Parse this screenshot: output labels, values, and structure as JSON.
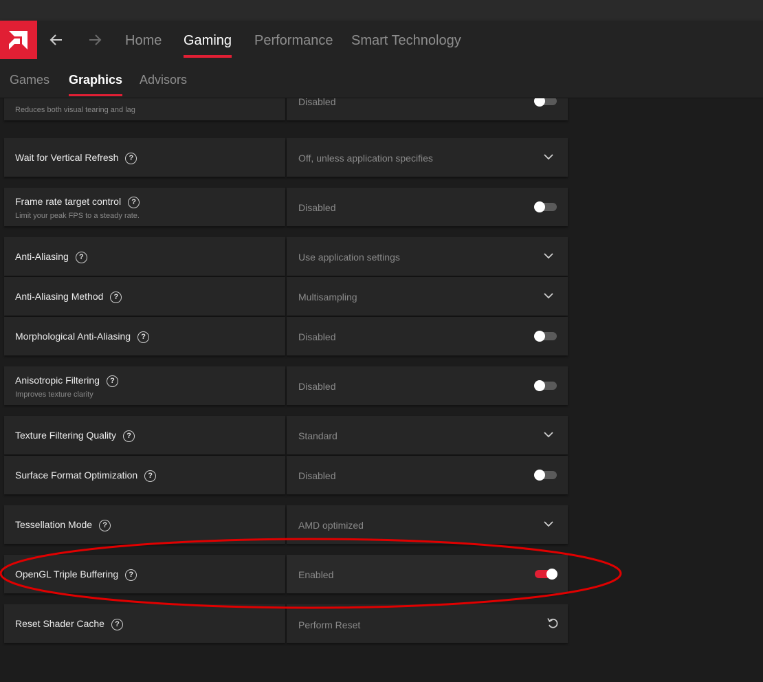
{
  "nav": {
    "tabs": [
      {
        "label": "Home"
      },
      {
        "label": "Gaming"
      },
      {
        "label": "Performance"
      },
      {
        "label": "Smart Technology"
      }
    ]
  },
  "subnav": {
    "tabs": [
      {
        "label": "Games"
      },
      {
        "label": "Graphics"
      },
      {
        "label": "Advisors"
      }
    ]
  },
  "settings": [
    {
      "label": "",
      "description": "Reduces both visual tearing and lag",
      "control": "toggle",
      "value": "Disabled",
      "enabled": false
    },
    {
      "label": "Wait for Vertical Refresh",
      "control": "dropdown",
      "value": "Off, unless application specifies"
    },
    {
      "label": "Frame rate target control",
      "description": "Limit your peak FPS to a steady rate.",
      "control": "toggle",
      "value": "Disabled",
      "enabled": false
    },
    {
      "label": "Anti-Aliasing",
      "control": "dropdown",
      "value": "Use application settings"
    },
    {
      "label": "Anti-Aliasing Method",
      "control": "dropdown",
      "value": "Multisampling"
    },
    {
      "label": "Morphological Anti-Aliasing",
      "control": "toggle",
      "value": "Disabled",
      "enabled": false
    },
    {
      "label": "Anisotropic Filtering",
      "description": "Improves texture clarity",
      "control": "toggle",
      "value": "Disabled",
      "enabled": false
    },
    {
      "label": "Texture Filtering Quality",
      "control": "dropdown",
      "value": "Standard"
    },
    {
      "label": "Surface Format Optimization",
      "control": "toggle",
      "value": "Disabled",
      "enabled": false
    },
    {
      "label": "Tessellation Mode",
      "control": "dropdown",
      "value": "AMD optimized"
    },
    {
      "label": "OpenGL Triple Buffering",
      "control": "toggle",
      "value": "Enabled",
      "enabled": true
    },
    {
      "label": "Reset Shader Cache",
      "control": "action",
      "value": "Perform Reset"
    }
  ],
  "help_glyph": "?",
  "colors": {
    "accent": "#e11f34",
    "annotation": "#e00000",
    "background": "#1c1c1c",
    "panel": "#262626"
  },
  "icons": {
    "logo": "amd-logo-icon",
    "back": "arrow-left-icon",
    "forward": "arrow-right-icon",
    "help": "help-circle-icon",
    "dropdown": "chevron-down-icon",
    "reset": "reset-icon"
  }
}
